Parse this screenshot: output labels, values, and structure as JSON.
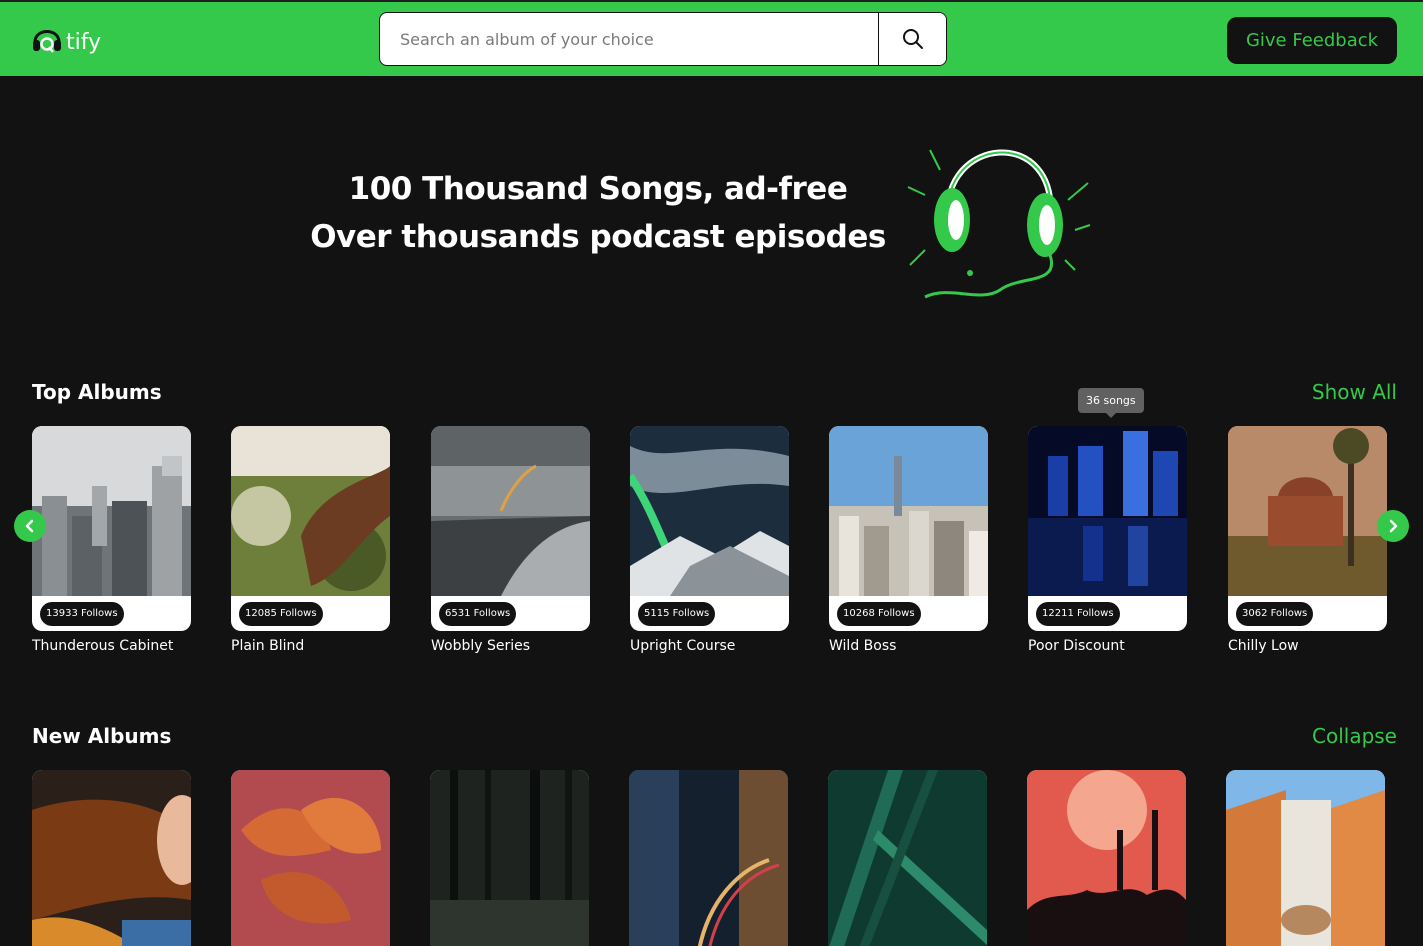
{
  "header": {
    "logo_text": "tify",
    "logo_icon": "headphones-icon",
    "search_placeholder": "Search an album of your choice",
    "search_icon": "search-icon",
    "feedback_label": "Give Feedback"
  },
  "hero": {
    "line1": "100 Thousand Songs, ad-free",
    "line2": "Over thousands podcast episodes",
    "illustration": "headphones-illustration"
  },
  "top_albums": {
    "title": "Top Albums",
    "action_label": "Show All",
    "tooltip": "36 songs",
    "items": [
      {
        "name": "Thunderous Cabinet",
        "follows": "13933 Follows"
      },
      {
        "name": "Plain Blind",
        "follows": "12085 Follows"
      },
      {
        "name": "Wobbly Series",
        "follows": "6531 Follows"
      },
      {
        "name": "Upright Course",
        "follows": "5115 Follows"
      },
      {
        "name": "Wild Boss",
        "follows": "10268 Follows"
      },
      {
        "name": "Poor Discount",
        "follows": "12211 Follows"
      },
      {
        "name": "Chilly Low",
        "follows": "3062 Follows"
      }
    ]
  },
  "new_albums": {
    "title": "New Albums",
    "action_label": "Collapse"
  },
  "colors": {
    "accent": "#34c94a",
    "background": "#121212",
    "card": "#ffffff"
  }
}
